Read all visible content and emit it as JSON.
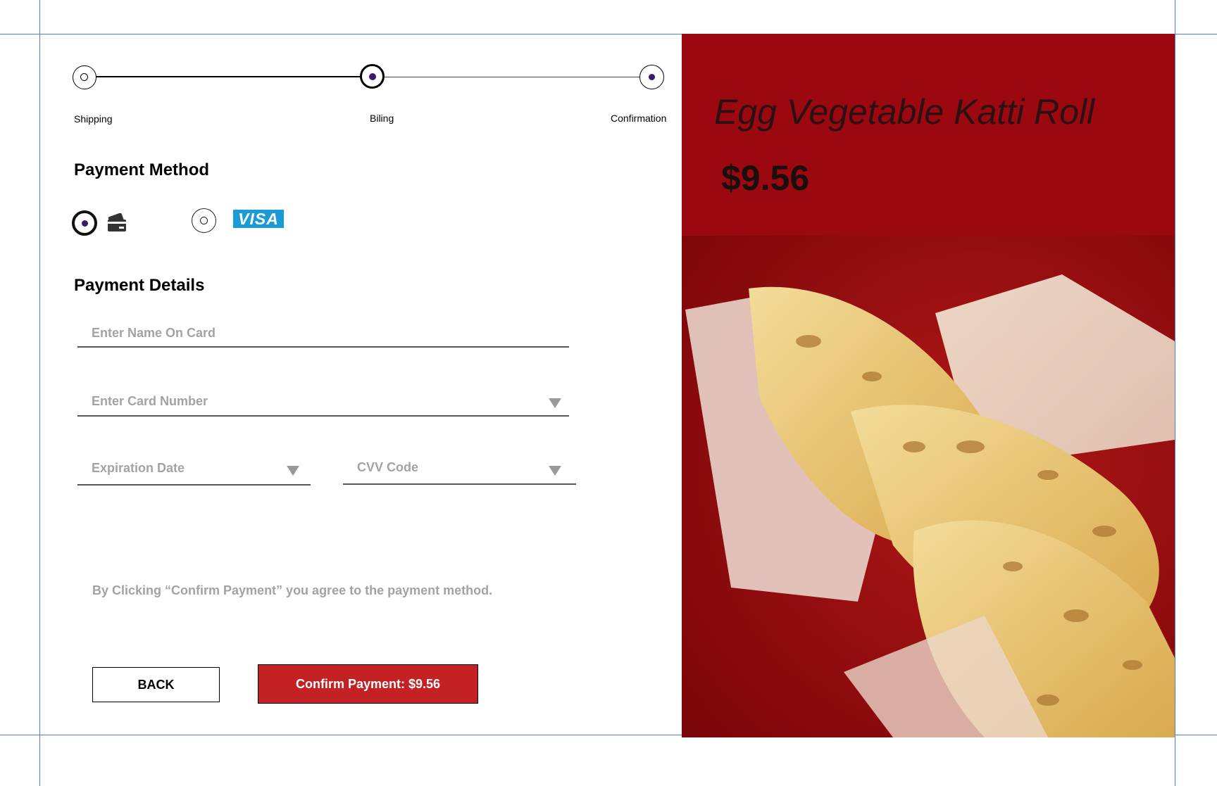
{
  "stepper": {
    "steps": [
      {
        "label": "Shipping",
        "state": "done"
      },
      {
        "label": "Biling",
        "state": "current"
      },
      {
        "label": "Confirmation",
        "state": "upcoming"
      }
    ]
  },
  "payment_method": {
    "title": "Payment Method",
    "options": [
      {
        "icon": "credit-card-icon",
        "selected": true
      },
      {
        "icon": "visa-logo",
        "logo_text": "VISA",
        "selected": false
      }
    ]
  },
  "payment_details": {
    "title": "Payment Details",
    "name_placeholder": "Enter Name On Card",
    "card_number_placeholder": "Enter Card Number",
    "expiration_placeholder": "Expiration Date",
    "cvv_placeholder": "CVV Code"
  },
  "agreement_text": "By Clicking “Confirm Payment” you agree to the payment method.",
  "buttons": {
    "back_label": "BACK",
    "confirm_label": "Confirm Payment: $9.56"
  },
  "product": {
    "name": "Egg Vegetable Katti Roll",
    "price": "$9.56",
    "image": "katti-roll-photo"
  },
  "colors": {
    "accent_red": "#c32124",
    "panel_red": "#9c0810",
    "stepper_dot": "#3a1a6e",
    "visa_blue": "#1a9ad6",
    "placeholder_gray": "#a3a3a3"
  }
}
